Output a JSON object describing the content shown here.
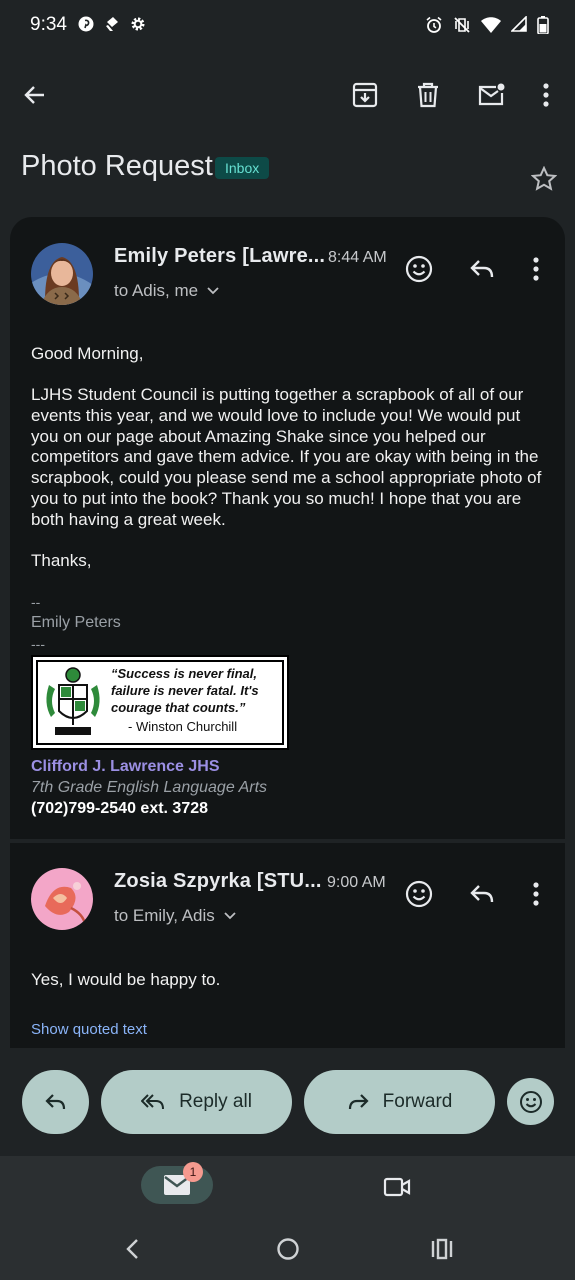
{
  "status_bar": {
    "time": "9:34"
  },
  "toolbar": {
    "back": "back-arrow-icon",
    "archive": "archive-icon",
    "delete": "trash-icon",
    "mark_unread": "mark-unread-icon",
    "more": "more-vert-icon"
  },
  "thread": {
    "subject": "Photo Request",
    "label": "Inbox"
  },
  "messages": [
    {
      "sender": "Emily Peters [Lawre...",
      "time": "8:44 AM",
      "recipients": "to Adis, me",
      "greeting": "Good Morning,",
      "paragraph": "LJHS Student Council is putting together a scrapbook of all of our events this year, and we would love to include you! We would put you on our page about Amazing Shake since you helped our competitors and gave them advice. If you are okay with being in the scrapbook, could you please send me a school appropriate photo of you to put into the book? Thank you so much! I hope that you are both having a great week.",
      "closing": "Thanks,",
      "sig_dash1": "--",
      "sig_name": "Emily Peters",
      "sig_dash2": "---",
      "quote": "“Success is never final, failure is never fatal. It's courage that counts.”",
      "quote_author": "-      Winston Churchill",
      "school": "Clifford J. Lawrence JHS",
      "role": "7th Grade English Language Arts",
      "phone": "(702)799-2540 ext. 3728"
    },
    {
      "sender": "Zosia Szpyrka [STU...",
      "time": "9:00 AM",
      "recipients": "to Emily, Adis",
      "body": "Yes, I would be happy to.",
      "show_quoted": "Show quoted text"
    }
  ],
  "actions": {
    "reply_all": "Reply all",
    "forward": "Forward"
  },
  "bottom_nav": {
    "mail_badge": "1"
  },
  "colors": {
    "accent": "#b3ccc8",
    "link": "#8ab4f8",
    "school": "#9b8fe3",
    "badge_bg": "#0d4a47",
    "badge_text": "#66e0d2"
  }
}
